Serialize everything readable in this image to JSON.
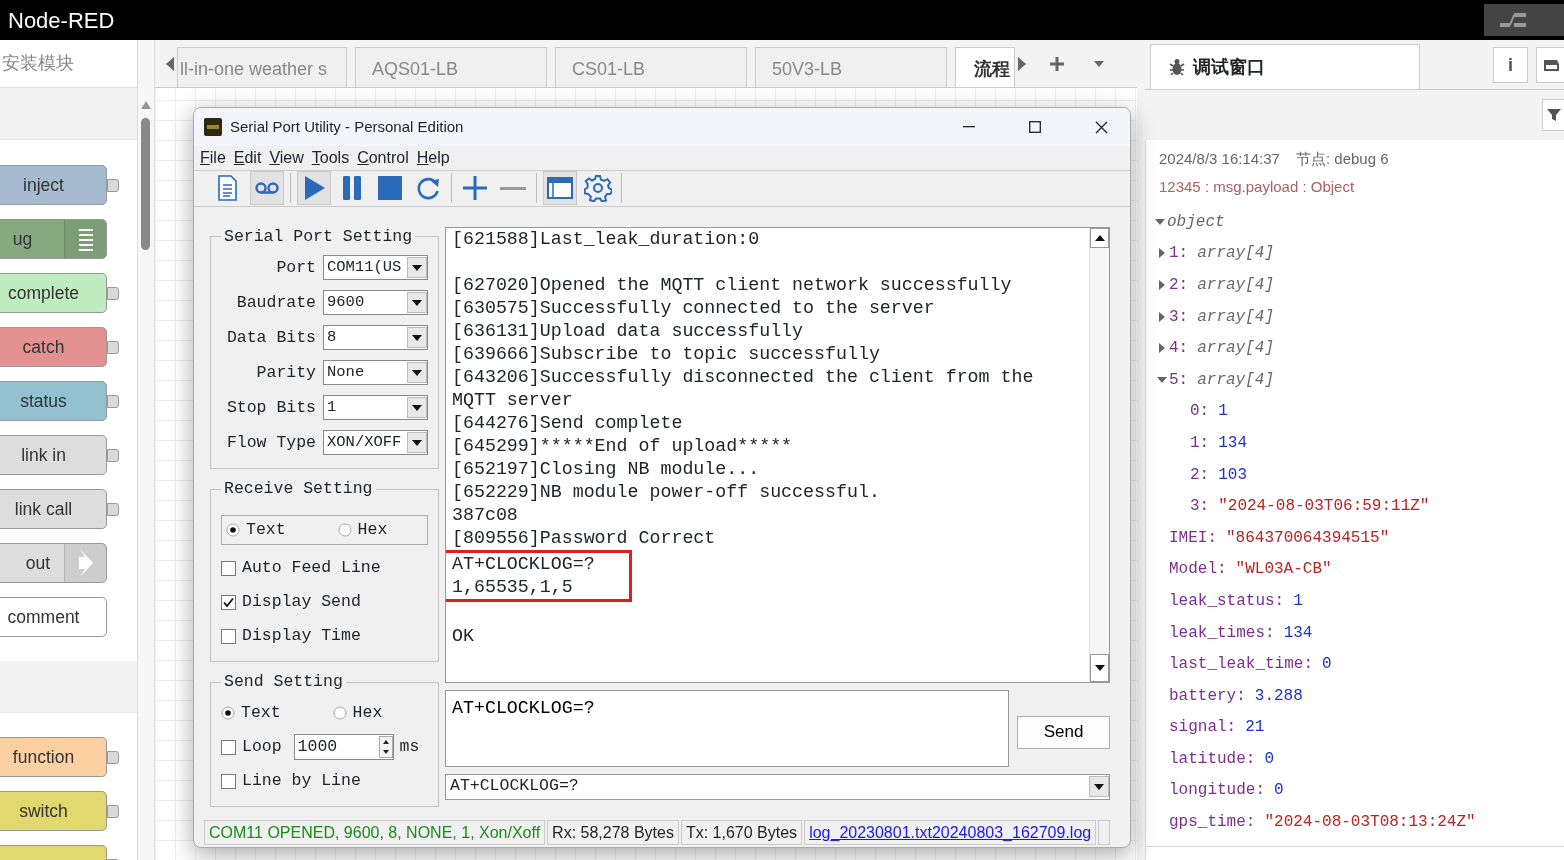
{
  "app": {
    "title": "Node-RED"
  },
  "palette": {
    "filter_placeholder": "安装模块",
    "nodes": [
      {
        "label": "inject",
        "color": "#a6bbcf",
        "kind": "port"
      },
      {
        "label": "ug",
        "color": "#87a980",
        "kind": "debug"
      },
      {
        "label": "complete",
        "color": "#c0edc0",
        "kind": "port"
      },
      {
        "label": "catch",
        "color": "#e49191",
        "kind": "port"
      },
      {
        "label": "status",
        "color": "#94c1d0",
        "kind": "port"
      },
      {
        "label": "link in",
        "color": "#dddddd",
        "kind": "port"
      },
      {
        "label": "link call",
        "color": "#dddddd",
        "kind": "port"
      },
      {
        "label": "out",
        "color": "#dddddd",
        "kind": "link"
      },
      {
        "label": "comment",
        "color": "#ffffff",
        "kind": "plain"
      },
      {
        "kind": "category"
      },
      {
        "label": "function",
        "color": "#fdd0a2",
        "kind": "port"
      },
      {
        "label": "switch",
        "color": "#e2d96e",
        "kind": "port"
      },
      {
        "color": "#e2d96e",
        "kind": "port"
      }
    ]
  },
  "workspace_tabs": [
    {
      "label": "ll-in-one weather s",
      "selected": false
    },
    {
      "label": "AQS01-LB",
      "selected": false
    },
    {
      "label": "CS01-LB",
      "selected": false
    },
    {
      "label": "50V3-LB",
      "selected": false
    },
    {
      "label": "流程",
      "selected": true
    }
  ],
  "sidebar": {
    "tab": {
      "label": "调试窗口",
      "selected": true
    },
    "info_button": "i",
    "messages": [
      {
        "time": "2024/8/3 16:14:37",
        "node": "节点: debug 6",
        "topic": "12345 : msg.payload : Object",
        "tree": {
          "label": "object",
          "expanded": true,
          "children": [
            {
              "key": "1:",
              "value": "array[4]",
              "kind": "type",
              "expanded": false
            },
            {
              "key": "2:",
              "value": "array[4]",
              "kind": "type",
              "expanded": false
            },
            {
              "key": "3:",
              "value": "array[4]",
              "kind": "type",
              "expanded": false
            },
            {
              "key": "4:",
              "value": "array[4]",
              "kind": "type",
              "expanded": false
            },
            {
              "key": "5:",
              "value": "array[4]",
              "kind": "type",
              "expanded": true,
              "children": [
                {
                  "key": "0:",
                  "value": "1",
                  "kind": "number"
                },
                {
                  "key": "1:",
                  "value": "134",
                  "kind": "number"
                },
                {
                  "key": "2:",
                  "value": "103",
                  "kind": "number"
                },
                {
                  "key": "3:",
                  "value": "\"2024-08-03T06:59:11Z\"",
                  "kind": "string"
                }
              ]
            },
            {
              "key": "IMEI:",
              "value": "\"864370064394515\"",
              "kind": "string"
            },
            {
              "key": "Model:",
              "value": "\"WL03A-CB\"",
              "kind": "string"
            },
            {
              "key": "leak_status:",
              "value": "1",
              "kind": "number"
            },
            {
              "key": "leak_times:",
              "value": "134",
              "kind": "number"
            },
            {
              "key": "last_leak_time:",
              "value": "0",
              "kind": "number"
            },
            {
              "key": "battery:",
              "value": "3.288",
              "kind": "number"
            },
            {
              "key": "signal:",
              "value": "21",
              "kind": "number"
            },
            {
              "key": "latitude:",
              "value": "0",
              "kind": "number"
            },
            {
              "key": "longitude:",
              "value": "0",
              "kind": "number"
            },
            {
              "key": "gps_time:",
              "value": "\"2024-08-03T08:13:24Z\"",
              "kind": "string"
            }
          ]
        }
      }
    ]
  },
  "serial": {
    "title": "Serial Port Utility - Personal Edition",
    "menu": [
      "File",
      "Edit",
      "View",
      "Tools",
      "Control",
      "Help"
    ],
    "toolbar": [
      {
        "kind": "document",
        "pressed": false
      },
      {
        "kind": "record",
        "pressed": true
      },
      {
        "kind": "play",
        "pressed": true
      },
      {
        "kind": "pause",
        "pressed": false
      },
      {
        "kind": "stop",
        "pressed": false
      },
      {
        "kind": "refresh",
        "pressed": false
      },
      {
        "kind": "add",
        "pressed": false
      },
      {
        "kind": "remove",
        "pressed": false
      },
      {
        "kind": "window",
        "pressed": true
      },
      {
        "kind": "settings",
        "pressed": false
      }
    ],
    "port_setting": {
      "title": "Serial Port Setting",
      "fields": [
        {
          "label": "Port",
          "value": "COM11(US"
        },
        {
          "label": "Baudrate",
          "value": "9600"
        },
        {
          "label": "Data Bits",
          "value": "8"
        },
        {
          "label": "Parity",
          "value": "None"
        },
        {
          "label": "Stop Bits",
          "value": "1"
        },
        {
          "label": "Flow Type",
          "value": "XON/XOFF"
        }
      ]
    },
    "receive_setting": {
      "title": "Receive Setting",
      "modes": [
        {
          "label": "Text",
          "selected": true
        },
        {
          "label": "Hex",
          "selected": false
        }
      ],
      "options": [
        {
          "label": "Auto Feed Line",
          "checked": false
        },
        {
          "label": "Display Send",
          "checked": true
        },
        {
          "label": "Display Time",
          "checked": false
        }
      ]
    },
    "send_setting": {
      "title": "Send Setting",
      "modes": [
        {
          "label": "Text",
          "selected": true
        },
        {
          "label": "Hex",
          "selected": false
        }
      ],
      "loop": {
        "label": "Loop",
        "checked": false,
        "value": "1000",
        "unit": "ms"
      },
      "line_by_line": {
        "label": "Line by Line",
        "checked": false
      }
    },
    "receive_lines": [
      {
        "text": "[621588]Last_leak_duration:0",
        "highlighted": false
      },
      {
        "kind": "blank"
      },
      {
        "text": "[627020]Opened the MQTT client network successfully",
        "highlighted": false
      },
      {
        "text": "[630575]Successfully connected to the server",
        "highlighted": false
      },
      {
        "text": "[636131]Upload data successfully",
        "highlighted": false
      },
      {
        "text": "[639666]Subscribe to topic successfully",
        "highlighted": false
      },
      {
        "text": "[643206]Successfully disconnected the client from the",
        "highlighted": false
      },
      {
        "text": "MQTT server",
        "highlighted": false
      },
      {
        "text": "[644276]Send complete",
        "highlighted": false
      },
      {
        "text": "[645299]*****End of upload*****",
        "highlighted": false
      },
      {
        "text": "[652197]Closing NB module...",
        "highlighted": false
      },
      {
        "text": "[652229]NB module power-off successful.",
        "highlighted": false
      },
      {
        "text": "387c08",
        "highlighted": false
      },
      {
        "text": "[809556]Password Correct",
        "highlighted": false
      },
      {
        "text": "AT+CLOCKLOG=?",
        "highlighted": true
      },
      {
        "text": "1,65535,1,5",
        "highlighted": true
      },
      {
        "kind": "blank"
      },
      {
        "text": "OK",
        "highlighted": false
      }
    ],
    "send_text": "AT+CLOCKLOG=?",
    "send_button": "Send",
    "history": "AT+CLOCKLOG=?",
    "status": {
      "connection": "COM11 OPENED, 9600, 8, NONE, 1, Xon/Xoff",
      "rx": "Rx: 58,278 Bytes",
      "tx": "Tx: 1,670 Bytes",
      "log": "log_20230801.txt20240803_162709.log"
    }
  }
}
